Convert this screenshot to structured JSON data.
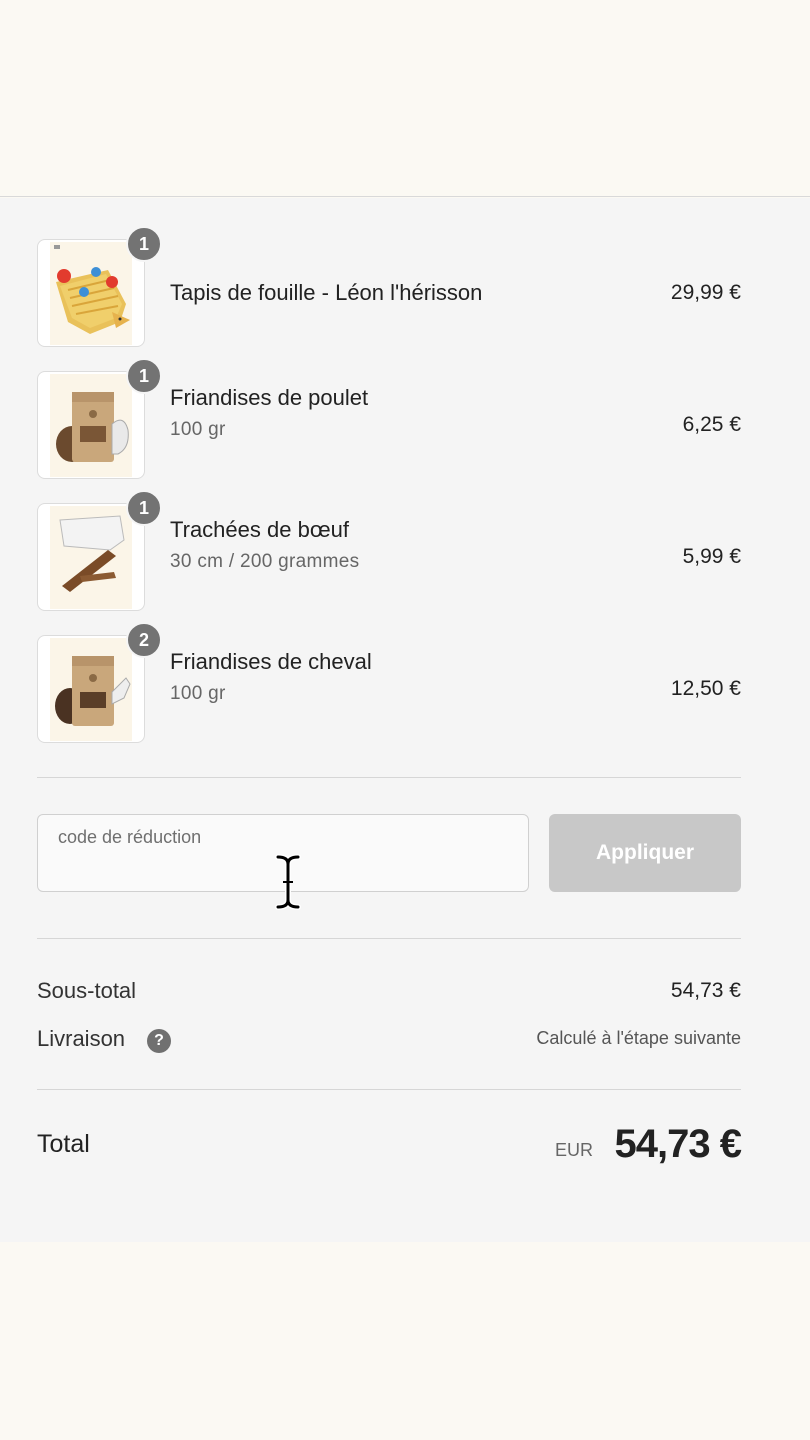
{
  "colors": {
    "page_background": "#fbf9f3",
    "summary_background": "#f5f5f5",
    "badge": "#737373",
    "apply_button_disabled": "#c8c8c8"
  },
  "cart": {
    "items": [
      {
        "quantity": "1",
        "name": "Tapis de fouille - Léon l'hérisson",
        "variant": "",
        "price": "29,99 €",
        "icon": "hedgehog-snuffle-mat-image"
      },
      {
        "quantity": "1",
        "name": "Friandises de poulet",
        "variant": "100 gr",
        "price": "6,25 €",
        "icon": "chicken-treats-bag-image"
      },
      {
        "quantity": "1",
        "name": "Trachées de bœuf",
        "variant": "30 cm / 200 grammes",
        "price": "5,99 €",
        "icon": "beef-trachea-chew-image"
      },
      {
        "quantity": "2",
        "name": "Friandises de cheval",
        "variant": "100 gr",
        "price": "12,50 €",
        "icon": "horse-treats-bag-image"
      }
    ]
  },
  "discount": {
    "placeholder": "code de réduction",
    "apply_label": "Appliquer"
  },
  "totals": {
    "subtotal_label": "Sous-total",
    "subtotal_value": "54,73 €",
    "shipping_label": "Livraison",
    "shipping_help": "?",
    "shipping_value": "Calculé à l'étape suivante",
    "total_label": "Total",
    "currency": "EUR",
    "total_value": "54,73 €"
  }
}
